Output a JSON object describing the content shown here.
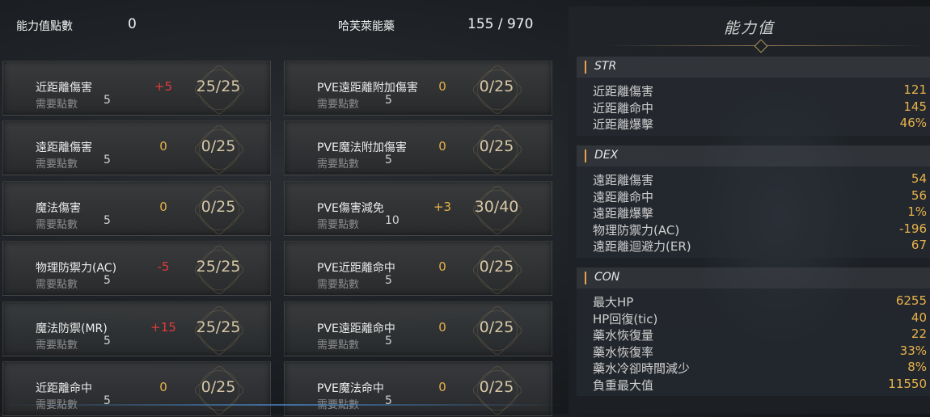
{
  "header": {
    "points_label": "能力值點數",
    "points_value": "0",
    "resource_label": "哈芙萊能藥",
    "resource_value": "155 / 970"
  },
  "skills_left": [
    {
      "name": "近距離傷害",
      "req_label": "需要點數",
      "req": "5",
      "bonus": "+5",
      "level": "25/25"
    },
    {
      "name": "遠距離傷害",
      "req_label": "需要點數",
      "req": "5",
      "bonus": "0",
      "level": "0/25"
    },
    {
      "name": "魔法傷害",
      "req_label": "需要點數",
      "req": "5",
      "bonus": "0",
      "level": "0/25"
    },
    {
      "name": "物理防禦力(AC)",
      "req_label": "需要點數",
      "req": "5",
      "bonus": "-5",
      "level": "25/25"
    },
    {
      "name": "魔法防禦(MR)",
      "req_label": "需要點數",
      "req": "5",
      "bonus": "+15",
      "level": "25/25"
    },
    {
      "name": "近距離命中",
      "req_label": "需要點數",
      "req": "5",
      "bonus": "0",
      "level": "0/25"
    }
  ],
  "skills_right": [
    {
      "name": "PVE遠距離附加傷害",
      "req_label": "需要點數",
      "req": "5",
      "bonus": "0",
      "level": "0/25"
    },
    {
      "name": "PVE魔法附加傷害",
      "req_label": "需要點數",
      "req": "5",
      "bonus": "0",
      "level": "0/25"
    },
    {
      "name": "PVE傷害減免",
      "req_label": "需要點數",
      "req": "10",
      "bonus": "+3",
      "level": "30/40"
    },
    {
      "name": "PVE近距離命中",
      "req_label": "需要點數",
      "req": "5",
      "bonus": "0",
      "level": "0/25"
    },
    {
      "name": "PVE遠距離命中",
      "req_label": "需要點數",
      "req": "5",
      "bonus": "0",
      "level": "0/25"
    },
    {
      "name": "PVE魔法命中",
      "req_label": "需要點數",
      "req": "5",
      "bonus": "0",
      "level": "0/25"
    }
  ],
  "stats_panel": {
    "title": "能力值",
    "sections": [
      {
        "title": "STR",
        "rows": [
          {
            "k": "近距離傷害",
            "v": "121"
          },
          {
            "k": "近距離命中",
            "v": "145"
          },
          {
            "k": "近距離爆擊",
            "v": "46%"
          }
        ]
      },
      {
        "title": "DEX",
        "rows": [
          {
            "k": "遠距離傷害",
            "v": "54"
          },
          {
            "k": "遠距離命中",
            "v": "56"
          },
          {
            "k": "遠距離爆擊",
            "v": "1%"
          },
          {
            "k": "物理防禦力(AC)",
            "v": "-196"
          },
          {
            "k": "遠距離迴避力(ER)",
            "v": "67"
          }
        ]
      },
      {
        "title": "CON",
        "rows": [
          {
            "k": "最大HP",
            "v": "6255"
          },
          {
            "k": "HP回復(tic)",
            "v": "40"
          },
          {
            "k": "藥水恢復量",
            "v": "22"
          },
          {
            "k": "藥水恢復率",
            "v": "33%"
          },
          {
            "k": "藥水冷卻時間減少",
            "v": "8%"
          },
          {
            "k": "負重最大值",
            "v": "11550"
          }
        ]
      }
    ]
  },
  "colors": {
    "bonus_positive": "#e23a3a",
    "bonus_zero": "#e8b24a",
    "stat_value": "#e8b24a",
    "section_bar": "#e8a24a"
  }
}
